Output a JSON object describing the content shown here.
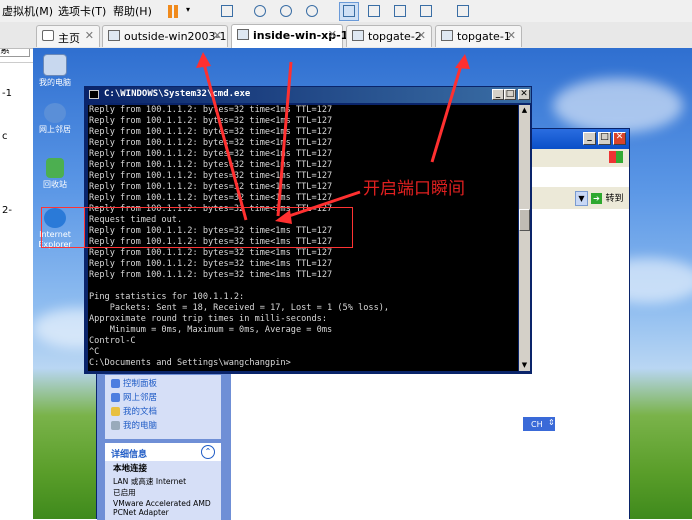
{
  "menubar": {
    "items": [
      "虚拟机(M)",
      "选项卡(T)",
      "帮助(H)"
    ]
  },
  "tabs": [
    {
      "label": "主页",
      "icon": "home-icon"
    },
    {
      "label": "outside-win2003-1",
      "icon": "vm-icon"
    },
    {
      "label": "inside-win-xp-1",
      "icon": "vm-icon",
      "active": true
    },
    {
      "label": "topgate-2",
      "icon": "vm-icon"
    },
    {
      "label": "topgate-1",
      "icon": "vm-icon"
    }
  ],
  "left_panel": {
    "search_suffix": "索",
    "close_glyph": "x",
    "fragments": [
      "-1",
      "c",
      "2-"
    ]
  },
  "desktop": {
    "icons": [
      "我的电脑",
      "网上邻居",
      "回收站",
      "Internet Explorer"
    ]
  },
  "cmd": {
    "title": "C:\\WINDOWS\\System32\\cmd.exe",
    "lines": [
      "Reply from 100.1.1.2: bytes=32 time<1ms TTL=127",
      "Reply from 100.1.1.2: bytes=32 time<1ms TTL=127",
      "Reply from 100.1.1.2: bytes=32 time<1ms TTL=127",
      "Reply from 100.1.1.2: bytes=32 time<1ms TTL=127",
      "Reply from 100.1.1.2: bytes=32 time<1ms TTL=127",
      "Reply from 100.1.1.2: bytes=32 time<1ms TTL=127",
      "Reply from 100.1.1.2: bytes=32 time<1ms TTL=127",
      "Reply from 100.1.1.2: bytes=32 time<1ms TTL=127",
      "Reply from 100.1.1.2: bytes=32 time<1ms TTL=127",
      "Reply from 100.1.1.2: bytes=32 time<1ms TTL=127",
      "Request timed out.",
      "Reply from 100.1.1.2: bytes=32 time<1ms TTL=127",
      "Reply from 100.1.1.2: bytes=32 time<1ms TTL=127",
      "Reply from 100.1.1.2: bytes=32 time<1ms TTL=127",
      "Reply from 100.1.1.2: bytes=32 time<1ms TTL=127",
      "Reply from 100.1.1.2: bytes=32 time<1ms TTL=127",
      "",
      "Ping statistics for 100.1.1.2:",
      "    Packets: Sent = 18, Received = 17, Lost = 1 (5% loss),",
      "Approximate round trip times in milli-seconds:",
      "    Minimum = 0ms, Maximum = 0ms, Average = 0ms",
      "Control-C",
      "^C",
      "C:\\Documents and Settings\\wangchangpin>"
    ]
  },
  "ie": {
    "go_label": "转到",
    "tasks": [
      "控制面板",
      "网上邻居",
      "我的文档",
      "我的电脑"
    ],
    "details_header": "详细信息",
    "details": [
      "本地连接",
      "LAN 或高速 Internet",
      "已启用",
      "VMware Accelerated AMD",
      "PCNet Adapter"
    ],
    "lang_indicator": "CH"
  },
  "annotation": {
    "text": "开启端口瞬间",
    "color": "#e02020"
  }
}
